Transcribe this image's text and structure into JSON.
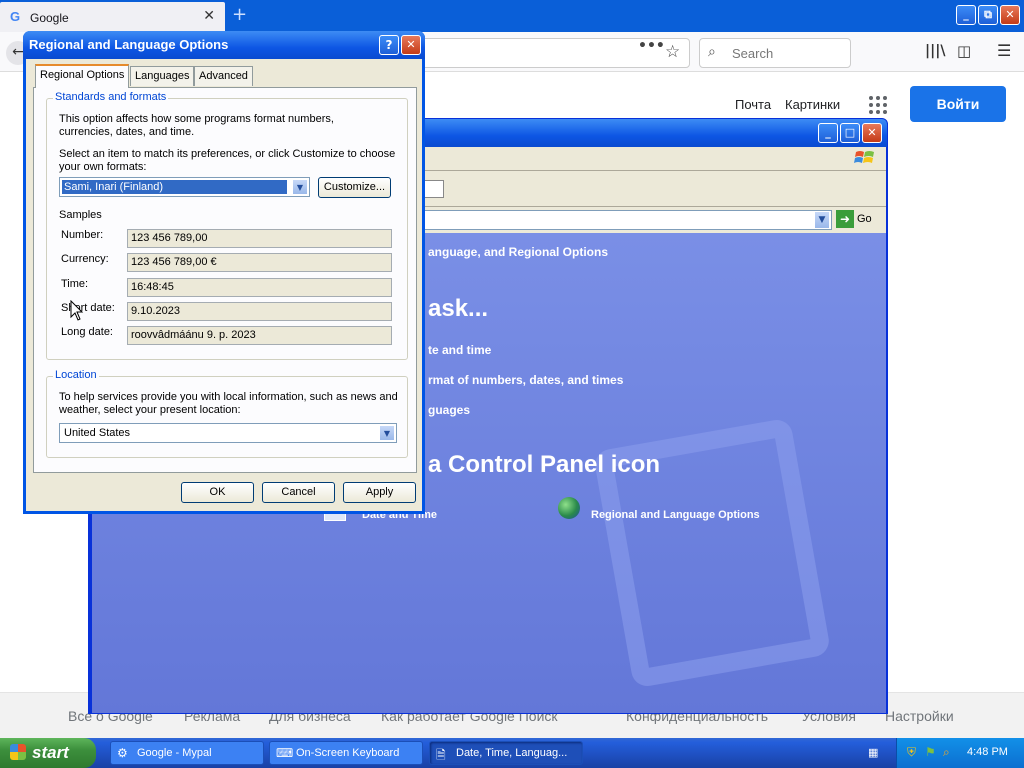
{
  "browser": {
    "tab_title": "Google",
    "tab_favicon": "G",
    "tab_close": "✕",
    "new_tab": "+",
    "search_placeholder": "Search",
    "url_more": "•••",
    "star": "☆",
    "library": "|||\\",
    "sidebar_toggle": "◫",
    "menu": "☰",
    "back": "←",
    "window_buttons": [
      "_",
      "⧉",
      "✕"
    ]
  },
  "google": {
    "mail": "Почта",
    "images": "Картинки",
    "signin": "Войти",
    "footer": {
      "about": "Все о Google",
      "ads": "Реклама",
      "business": "Для бизнеса",
      "how_search": "Как работает Google Поиск",
      "privacy": "Конфиденциальность",
      "terms": "Условия",
      "settings": "Настройки"
    }
  },
  "control_panel": {
    "go": "Go",
    "breadcrumb": "anguage, and Regional Options",
    "pick_task": "ask...",
    "tasks": [
      "te and time",
      "rmat of numbers, dates, and times",
      "guages"
    ],
    "or_pick": "a Control Panel icon",
    "icon_date_time": "Date and Time",
    "icon_regional": "Regional and Language Options"
  },
  "dialog": {
    "title": "Regional and Language Options",
    "help": "?",
    "close": "✕",
    "tabs": [
      "Regional Options",
      "Languages",
      "Advanced"
    ],
    "standards": {
      "legend": "Standards and formats",
      "desc": "This option affects how some programs format numbers, currencies, dates, and time.",
      "select_text": "Select an item to match its preferences, or click Customize to choose your own formats:",
      "selected_locale": "Sami, Inari (Finland)",
      "customize": "Customize...",
      "samples_heading": "Samples",
      "samples": [
        {
          "label": "Number:",
          "value": "123 456 789,00"
        },
        {
          "label": "Currency:",
          "value": "123 456 789,00 €"
        },
        {
          "label": "Time:",
          "value": "16:48:45"
        },
        {
          "label": "Short date:",
          "value": "9.10.2023"
        },
        {
          "label": "Long date:",
          "value": "roovvâdmáánu 9. p. 2023"
        }
      ]
    },
    "location": {
      "legend": "Location",
      "desc": "To help services provide you with local information, such as news and weather, select your present location:",
      "value": "United States"
    },
    "buttons": {
      "ok": "OK",
      "cancel": "Cancel",
      "apply": "Apply"
    }
  },
  "taskbar": {
    "start": "start",
    "items": [
      {
        "label": "Google - Mypal",
        "icon": "⚙"
      },
      {
        "label": "On-Screen Keyboard",
        "icon": "⌨"
      },
      {
        "label": "Date, Time, Languag...",
        "icon": "🗎"
      }
    ],
    "keyboard_tray": "▦",
    "clock": "4:48 PM"
  },
  "colors": {
    "xp_blue": "#0055e5",
    "cp_content": "#6a7fdd",
    "google_blue": "#1a73e8"
  }
}
